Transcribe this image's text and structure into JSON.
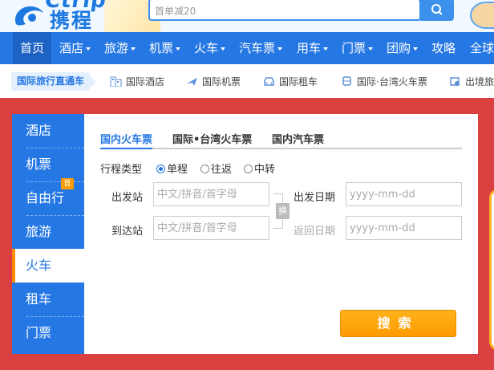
{
  "header": {
    "brand_en": "Ctrip",
    "brand_cn": "携程",
    "search_placeholder": "首单减20"
  },
  "nav": {
    "items": [
      {
        "label": "首页",
        "dropdown": false,
        "active": true
      },
      {
        "label": "酒店",
        "dropdown": true
      },
      {
        "label": "旅游",
        "dropdown": true
      },
      {
        "label": "机票",
        "dropdown": true
      },
      {
        "label": "火车",
        "dropdown": true
      },
      {
        "label": "汽车票",
        "dropdown": true
      },
      {
        "label": "用车",
        "dropdown": true
      },
      {
        "label": "门票",
        "dropdown": true
      },
      {
        "label": "团购",
        "dropdown": true
      },
      {
        "label": "攻略",
        "dropdown": false
      },
      {
        "label": "全球",
        "dropdown": false
      }
    ]
  },
  "subnav": {
    "tag": "国际旅行直通车",
    "items": [
      {
        "label": "国际酒店",
        "icon": "building-icon"
      },
      {
        "label": "国际机票",
        "icon": "plane-icon"
      },
      {
        "label": "国际租车",
        "icon": "car-icon"
      },
      {
        "label": "国际·台湾火车票",
        "icon": "train-icon"
      },
      {
        "label": "出境旅",
        "icon": "ticket-icon"
      }
    ]
  },
  "sidebar": {
    "items": [
      {
        "label": "酒店"
      },
      {
        "label": "机票"
      },
      {
        "label": "自由行"
      },
      {
        "label": "旅游"
      },
      {
        "label": "火车",
        "active": true
      },
      {
        "label": "租车"
      },
      {
        "label": "门票"
      }
    ],
    "badge": "首"
  },
  "form": {
    "tabs": [
      "国内火车票",
      "国际•台湾火车票",
      "国内汽车票"
    ],
    "trip_type_label": "行程类型",
    "trip_options": [
      "单程",
      "往返",
      "中转"
    ],
    "selected_trip": "单程",
    "from_label": "出发站",
    "to_label": "到达站",
    "station_placeholder": "中文/拼音/首字母",
    "depart_label": "出发日期",
    "return_label": "返回日期",
    "date_placeholder": "yyyy-mm-dd",
    "swap_label": "换",
    "search_label": "搜索"
  },
  "colors": {
    "brand_blue": "#2577e3",
    "banner_red": "#d9403f",
    "search_orange": "#ff9a00"
  }
}
